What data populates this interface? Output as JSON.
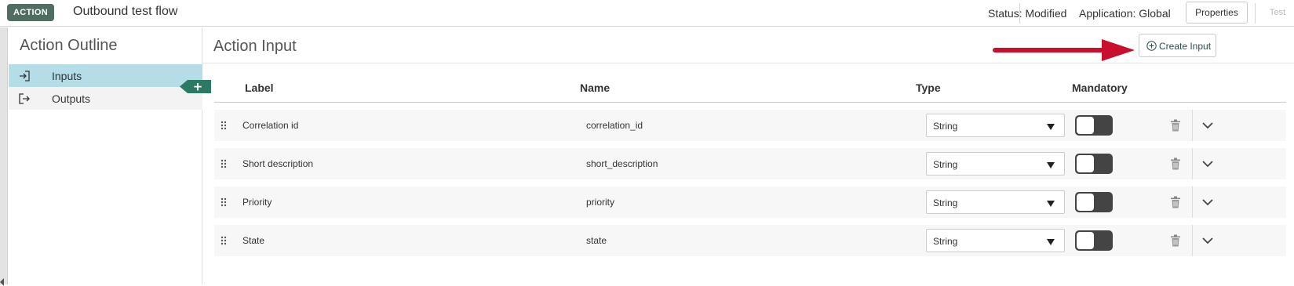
{
  "header": {
    "badge": "ACTION",
    "flow_title": "Outbound test flow",
    "status": "Status: Modified",
    "application": "Application: Global",
    "properties_label": "Properties",
    "test_label": "Test"
  },
  "outline": {
    "title": "Action Outline",
    "items": [
      {
        "label": "Inputs",
        "icon": "input-icon",
        "active": true
      },
      {
        "label": "Outputs",
        "icon": "output-icon",
        "active": false
      }
    ],
    "plus_label": "+"
  },
  "main": {
    "title": "Action Input",
    "create_label": "Create Input",
    "columns": [
      "Label",
      "Name",
      "Type",
      "Mandatory"
    ],
    "rows": [
      {
        "label": "Correlation id",
        "name": "correlation_id",
        "type": "String",
        "mandatory": false
      },
      {
        "label": "Short description",
        "name": "short_description",
        "type": "String",
        "mandatory": false
      },
      {
        "label": "Priority",
        "name": "priority",
        "type": "String",
        "mandatory": false
      },
      {
        "label": "State",
        "name": "state",
        "type": "String",
        "mandatory": false
      }
    ]
  },
  "colors": {
    "badge_bg": "#4f6e61",
    "active_item_bg": "#b4dde7",
    "plus_tab": "#2b7a66",
    "arrow": "#c8102e",
    "toggle_bg": "#444444"
  }
}
